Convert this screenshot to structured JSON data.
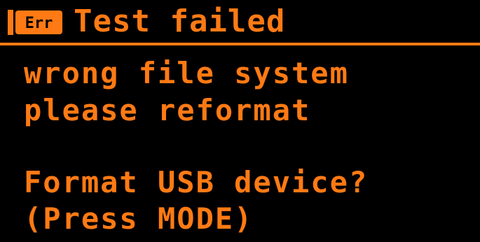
{
  "header": {
    "icon": "err-icon",
    "icon_text": "Err",
    "title": "Test failed"
  },
  "message": {
    "line1": "wrong file system",
    "line2": "please reformat"
  },
  "prompt": {
    "line1": "Format USB device?",
    "line2": "(Press MODE)"
  },
  "colors": {
    "foreground": "#ff7a14",
    "background": "#000000"
  }
}
